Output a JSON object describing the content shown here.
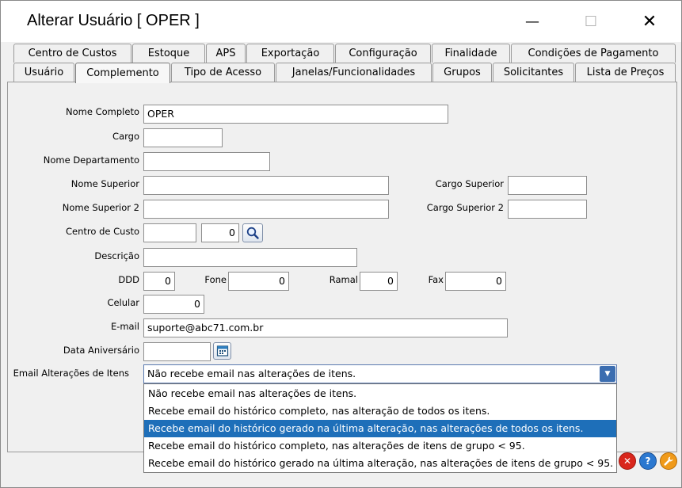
{
  "window": {
    "title": "Alterar Usuário [ OPER ]",
    "minimize": "—",
    "maximize": "☐",
    "close": "✕"
  },
  "tabs_row1": [
    {
      "label": "Centro de Custos"
    },
    {
      "label": "Estoque"
    },
    {
      "label": "APS"
    },
    {
      "label": "Exportação"
    },
    {
      "label": "Configuração"
    },
    {
      "label": "Finalidade"
    },
    {
      "label": "Condições de Pagamento"
    }
  ],
  "tabs_row2": [
    {
      "label": "Usuário"
    },
    {
      "label": "Complemento",
      "active": true
    },
    {
      "label": "Tipo de Acesso"
    },
    {
      "label": "Janelas/Funcionalidades"
    },
    {
      "label": "Grupos"
    },
    {
      "label": "Solicitantes"
    },
    {
      "label": "Lista de Preços"
    }
  ],
  "form": {
    "nome_completo": {
      "label": "Nome Completo",
      "value": "OPER"
    },
    "cargo": {
      "label": "Cargo",
      "value": ""
    },
    "nome_departamento": {
      "label": "Nome Departamento",
      "value": ""
    },
    "nome_superior": {
      "label": "Nome Superior",
      "value": ""
    },
    "cargo_superior": {
      "label": "Cargo Superior",
      "value": ""
    },
    "nome_superior_2": {
      "label": "Nome Superior 2",
      "value": ""
    },
    "cargo_superior_2": {
      "label": "Cargo Superior 2",
      "value": ""
    },
    "centro_de_custo": {
      "label": "Centro de Custo",
      "value": "",
      "code": "0"
    },
    "descricao": {
      "label": "Descrição",
      "value": ""
    },
    "ddd": {
      "label": "DDD",
      "value": "0"
    },
    "fone": {
      "label": "Fone",
      "value": "0"
    },
    "ramal": {
      "label": "Ramal",
      "value": "0"
    },
    "fax": {
      "label": "Fax",
      "value": "0"
    },
    "celular": {
      "label": "Celular",
      "value": "0"
    },
    "email": {
      "label": "E-mail",
      "value": "suporte@abc71.com.br"
    },
    "data_aniversario": {
      "label": "Data Aniversário",
      "value": ""
    },
    "email_alteracoes": {
      "label": "Email Alterações de Itens",
      "value": "Não recebe email nas alterações de itens.",
      "options": [
        "Não recebe email nas alterações de itens.",
        "Recebe email do histórico completo, nas alteração de todos os itens.",
        "Recebe email do histórico gerado na última alteração, nas alterações de todos os itens.",
        "Recebe email do histórico completo, nas alterações de itens de grupo < 95.",
        "Recebe email do histórico gerado na última alteração, nas alterações de itens de grupo < 95."
      ],
      "highlighted_index": 2
    }
  },
  "footer": {
    "cancel_icon": "✕",
    "help_icon": "?",
    "tools_icon": "wrench-icon"
  },
  "colors": {
    "selection": "#1e6fb9",
    "dropdown_arrow": "#3b6db0"
  }
}
